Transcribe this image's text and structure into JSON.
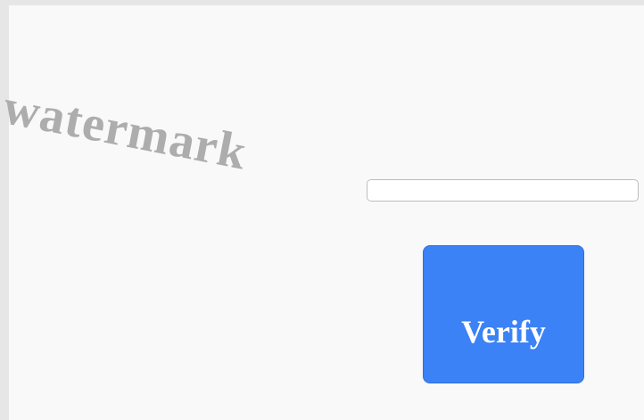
{
  "watermark": {
    "text": "watermark",
    "color": "#adadad"
  },
  "input": {
    "value": "",
    "placeholder": ""
  },
  "verify_button": {
    "label": "Verify",
    "color": "#3b82f6"
  }
}
